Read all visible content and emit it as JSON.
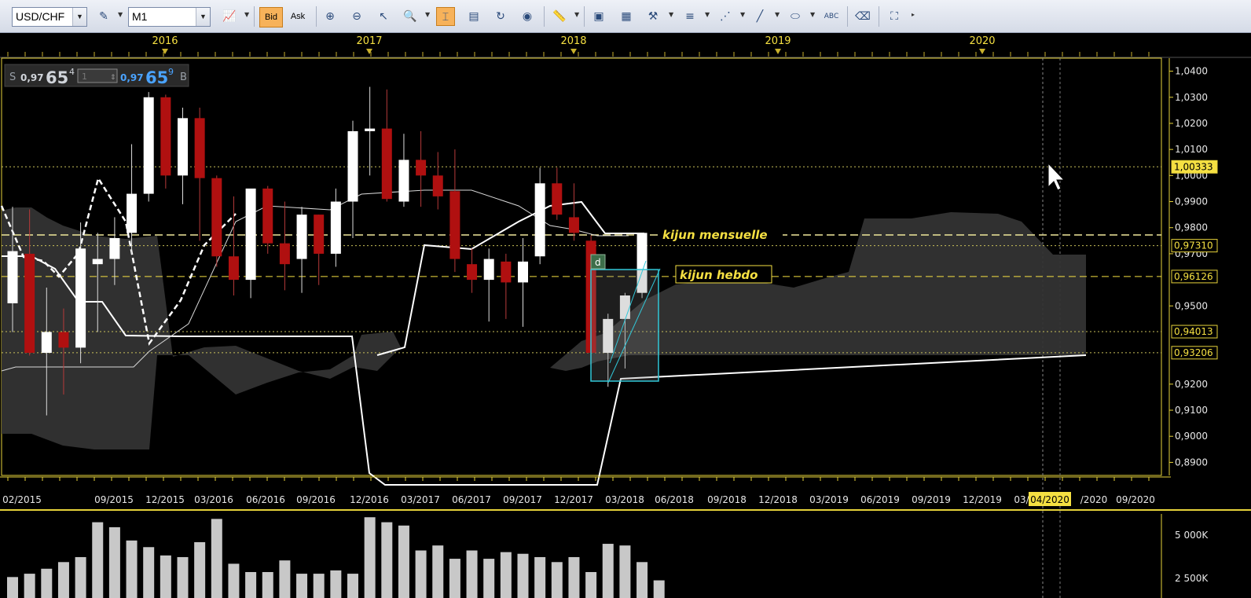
{
  "toolbar": {
    "symbol": "USD/CHF",
    "timeframe": "M1",
    "bid_label": "Bid",
    "ask_label": "Ask"
  },
  "colors": {
    "background": "#000000",
    "bull_candle": "#ffffff",
    "bear_candle": "#b01010",
    "cloud": "#333333",
    "frame": "#e6d23a",
    "label_text": "#f5e042",
    "selection": "#31c7d8"
  },
  "quote": {
    "sell_prefix": "S",
    "sell_big": "0,97",
    "sell_pips": "65",
    "sell_frac": "4",
    "lot": "1",
    "buy_big": "0,97",
    "buy_pips": "65",
    "buy_frac": "9",
    "buy_suffix": "B"
  },
  "annotations": {
    "kijun_monthly": "kijun mensuelle",
    "kijun_weekly": "kijun hebdo",
    "marker": "d"
  },
  "top_axis": [
    "2016",
    "2017",
    "2018",
    "2019",
    "2020"
  ],
  "time_axis": [
    "02/2015",
    "09/2015",
    "12/2015",
    "03/2016",
    "06/2016",
    "09/2016",
    "12/2016",
    "03/2017",
    "06/2017",
    "09/2017",
    "12/2017",
    "03/2018",
    "06/2018",
    "09/2018",
    "12/2018",
    "03/2019",
    "06/2019",
    "09/2019",
    "12/2019",
    "03/",
    "04/2020",
    "/2020",
    "09/2020"
  ],
  "price_axis": [
    "1,0400",
    "1,0300",
    "1,0200",
    "1,0100",
    "1,0000",
    "0,9900",
    "0,9800",
    "0,9700",
    "0,9500",
    "0,9200",
    "0,9100",
    "0,9000",
    "0,8900"
  ],
  "price_tags": [
    {
      "label": "1,00333",
      "value": 1.00333
    },
    {
      "label": "0,97310",
      "value": 0.9731
    },
    {
      "label": "0,96126",
      "value": 0.96126
    },
    {
      "label": "0,94013",
      "value": 0.94013
    },
    {
      "label": "0,93206",
      "value": 0.93206
    }
  ],
  "volume_axis": [
    "5 000K",
    "2 500K"
  ],
  "chart_data": {
    "type": "candlestick",
    "price_range": [
      0.885,
      1.045
    ],
    "candles": [
      {
        "date": "2015-01",
        "o": 0.951,
        "h": 0.988,
        "l": 0.94,
        "c": 0.971
      },
      {
        "date": "2015-03",
        "o": 0.97,
        "h": 0.987,
        "l": 0.931,
        "c": 0.932
      },
      {
        "date": "2015-05",
        "o": 0.932,
        "h": 0.957,
        "l": 0.908,
        "c": 0.94
      },
      {
        "date": "2015-06",
        "o": 0.94,
        "h": 0.949,
        "l": 0.916,
        "c": 0.934
      },
      {
        "date": "2015-07",
        "o": 0.934,
        "h": 0.982,
        "l": 0.928,
        "c": 0.972
      },
      {
        "date": "2015-09",
        "o": 0.966,
        "h": 0.978,
        "l": 0.94,
        "c": 0.968
      },
      {
        "date": "2015-10",
        "o": 0.968,
        "h": 0.984,
        "l": 0.958,
        "c": 0.976
      },
      {
        "date": "2015-11",
        "o": 0.978,
        "h": 1.012,
        "l": 0.97,
        "c": 0.993
      },
      {
        "date": "2015-12",
        "o": 0.993,
        "h": 1.032,
        "l": 0.99,
        "c": 1.03
      },
      {
        "date": "2016-01",
        "o": 1.03,
        "h": 1.031,
        "l": 0.995,
        "c": 1.0
      },
      {
        "date": "2016-02",
        "o": 1.0,
        "h": 1.026,
        "l": 0.989,
        "c": 1.022
      },
      {
        "date": "2016-03",
        "o": 1.022,
        "h": 1.026,
        "l": 0.975,
        "c": 0.999
      },
      {
        "date": "2016-04",
        "o": 0.999,
        "h": 1.0,
        "l": 0.965,
        "c": 0.969
      },
      {
        "date": "2016-05",
        "o": 0.969,
        "h": 0.992,
        "l": 0.954,
        "c": 0.96
      },
      {
        "date": "2016-06",
        "o": 0.96,
        "h": 0.995,
        "l": 0.953,
        "c": 0.995
      },
      {
        "date": "2016-07",
        "o": 0.995,
        "h": 0.996,
        "l": 0.97,
        "c": 0.974
      },
      {
        "date": "2016-08",
        "o": 0.974,
        "h": 0.99,
        "l": 0.956,
        "c": 0.966
      },
      {
        "date": "2016-09",
        "o": 0.968,
        "h": 0.988,
        "l": 0.955,
        "c": 0.985
      },
      {
        "date": "2016-10",
        "o": 0.985,
        "h": 0.985,
        "l": 0.958,
        "c": 0.97
      },
      {
        "date": "2016-11",
        "o": 0.97,
        "h": 0.995,
        "l": 0.965,
        "c": 0.99
      },
      {
        "date": "2016-12",
        "o": 0.99,
        "h": 1.021,
        "l": 0.976,
        "c": 1.017
      },
      {
        "date": "2017-01",
        "o": 1.017,
        "h": 1.034,
        "l": 1.0,
        "c": 1.018
      },
      {
        "date": "2017-02",
        "o": 1.018,
        "h": 1.033,
        "l": 0.99,
        "c": 0.991
      },
      {
        "date": "2017-03",
        "o": 0.99,
        "h": 1.016,
        "l": 0.988,
        "c": 1.006
      },
      {
        "date": "2017-04",
        "o": 1.006,
        "h": 1.017,
        "l": 0.988,
        "c": 1.0
      },
      {
        "date": "2017-05",
        "o": 1.0,
        "h": 1.009,
        "l": 0.987,
        "c": 0.992
      },
      {
        "date": "2017-06",
        "o": 0.994,
        "h": 1.01,
        "l": 0.963,
        "c": 0.968
      },
      {
        "date": "2017-07",
        "o": 0.966,
        "h": 0.972,
        "l": 0.955,
        "c": 0.96
      },
      {
        "date": "2017-08",
        "o": 0.96,
        "h": 0.972,
        "l": 0.944,
        "c": 0.968
      },
      {
        "date": "2017-09",
        "o": 0.967,
        "h": 0.97,
        "l": 0.945,
        "c": 0.959
      },
      {
        "date": "2017-10",
        "o": 0.959,
        "h": 0.976,
        "l": 0.942,
        "c": 0.967
      },
      {
        "date": "2017-11",
        "o": 0.969,
        "h": 1.003,
        "l": 0.966,
        "c": 0.997
      },
      {
        "date": "2017-12",
        "o": 0.997,
        "h": 1.003,
        "l": 0.983,
        "c": 0.985
      },
      {
        "date": "2018-01",
        "o": 0.984,
        "h": 0.997,
        "l": 0.975,
        "c": 0.978
      },
      {
        "date": "2018-02",
        "o": 0.975,
        "h": 0.977,
        "l": 0.926,
        "c": 0.932
      },
      {
        "date": "2018-03",
        "o": 0.932,
        "h": 0.947,
        "l": 0.919,
        "c": 0.945
      },
      {
        "date": "2018-04",
        "o": 0.945,
        "h": 0.955,
        "l": 0.926,
        "c": 0.954
      },
      {
        "date": "2018-05",
        "o": 0.955,
        "h": 0.978,
        "l": 0.953,
        "c": 0.978
      }
    ],
    "volume_range": [
      2000,
      6400
    ],
    "volumes": [
      2600,
      2800,
      3100,
      3500,
      3800,
      5900,
      5600,
      4800,
      4400,
      3900,
      3800,
      4700,
      6100,
      3400,
      2900,
      2900,
      3600,
      2800,
      2800,
      3000,
      2800,
      6200,
      5900,
      5700,
      4200,
      4500,
      3700,
      4200,
      3700,
      4100,
      4000,
      3800,
      3500,
      3800,
      2900,
      4600,
      4500,
      3500,
      2400
    ]
  }
}
